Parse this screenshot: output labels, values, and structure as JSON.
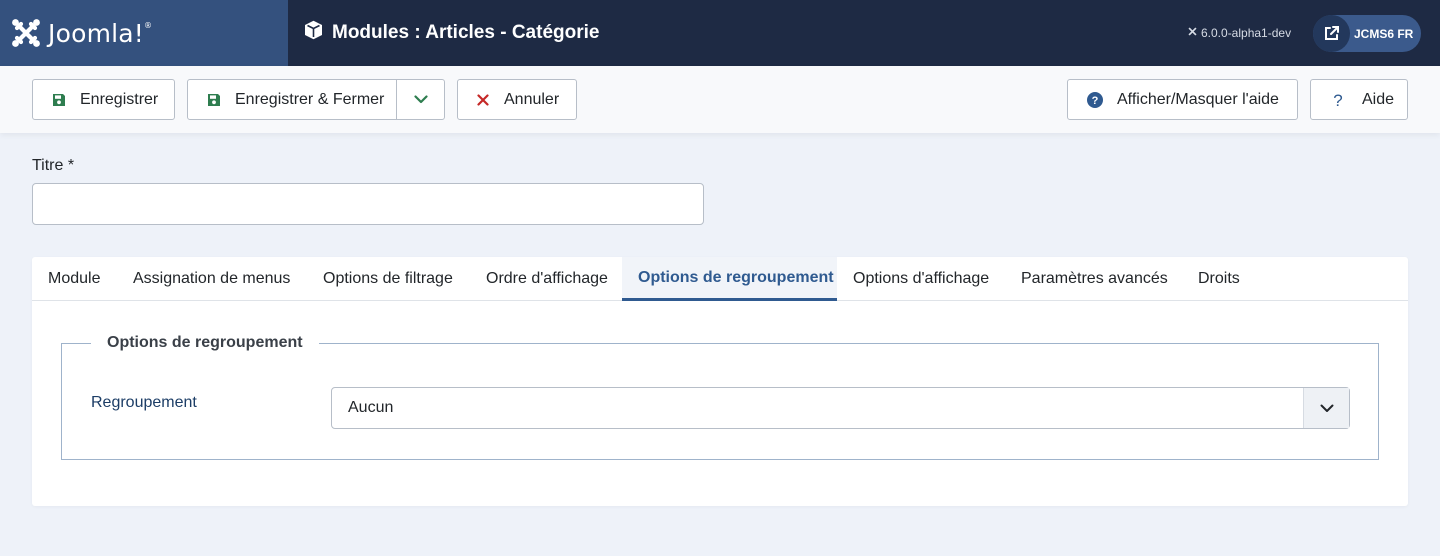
{
  "header": {
    "logo_text": "Joomla!",
    "page_title": "Modules : Articles - Catégorie",
    "version": "6.0.0-alpha1-dev",
    "site_label": "JCMS6 FR"
  },
  "toolbar": {
    "save_label": "Enregistrer",
    "save_close_label": "Enregistrer & Fermer",
    "cancel_label": "Annuler",
    "help_toggle_label": "Afficher/Masquer l'aide",
    "help_label": "Aide"
  },
  "form": {
    "title_label": "Titre *",
    "title_value": "",
    "title_placeholder": ""
  },
  "tabs": [
    {
      "label": "Module"
    },
    {
      "label": "Assignation de menus"
    },
    {
      "label": "Options de filtrage"
    },
    {
      "label": "Ordre d'affichage"
    },
    {
      "label": "Options de regroupement",
      "active": true
    },
    {
      "label": "Options d'affichage"
    },
    {
      "label": "Paramètres avancés"
    },
    {
      "label": "Droits"
    }
  ],
  "grouping": {
    "legend": "Options de regroupement",
    "field_label": "Regroupement",
    "selected": "Aucun"
  },
  "colors": {
    "header_bg": "#1e2a44",
    "logo_bg": "#34517e",
    "accent": "#2f5a90",
    "save_icon": "#2e7d4f",
    "cancel_icon": "#c52827"
  }
}
